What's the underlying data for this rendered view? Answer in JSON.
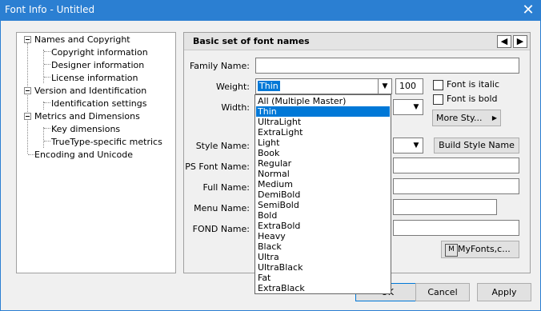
{
  "window": {
    "title": "Font Info - Untitled"
  },
  "tree": {
    "sections": [
      {
        "label": "Names and Copyright",
        "children": [
          "Copyright information",
          "Designer information",
          "License information"
        ]
      },
      {
        "label": "Version and Identification",
        "children": [
          "Identification settings"
        ]
      },
      {
        "label": "Metrics and Dimensions",
        "children": [
          "Key dimensions",
          "TrueType-specific metrics"
        ]
      }
    ],
    "last": "Encoding and Unicode"
  },
  "panel": {
    "title": "Basic set of font names",
    "prev_icon": "◀",
    "next_icon": "▶"
  },
  "form": {
    "family_name_label": "Family Name:",
    "family_name_value": "",
    "weight_label": "Weight:",
    "weight_value": "Thin",
    "weight_number": "100",
    "width_label": "Width:",
    "style_name_label": "Style Name:",
    "ps_font_name_label": "PS Font Name:",
    "full_name_label": "Full Name:",
    "menu_name_label": "Menu Name:",
    "fond_name_label": "FOND Name:",
    "font_is_italic": "Font is italic",
    "font_is_bold": "Font is bold",
    "more_styles": "More Sty...",
    "build_style_name": "Build Style Name",
    "myfonts": "MyFonts,c..."
  },
  "weight_options": [
    "All (Multiple Master)",
    "Thin",
    "UltraLight",
    "ExtraLight",
    "Light",
    "Book",
    "Regular",
    "Normal",
    "Medium",
    "DemiBold",
    "SemiBold",
    "Bold",
    "ExtraBold",
    "Heavy",
    "Black",
    "Ultra",
    "UltraBlack",
    "Fat",
    "ExtraBlack"
  ],
  "weight_selected_index": 1,
  "buttons": {
    "ok": "OK",
    "cancel": "Cancel",
    "apply": "Apply"
  },
  "colors": {
    "titlebar": "#2b7fd2",
    "selection": "#0078d7"
  }
}
